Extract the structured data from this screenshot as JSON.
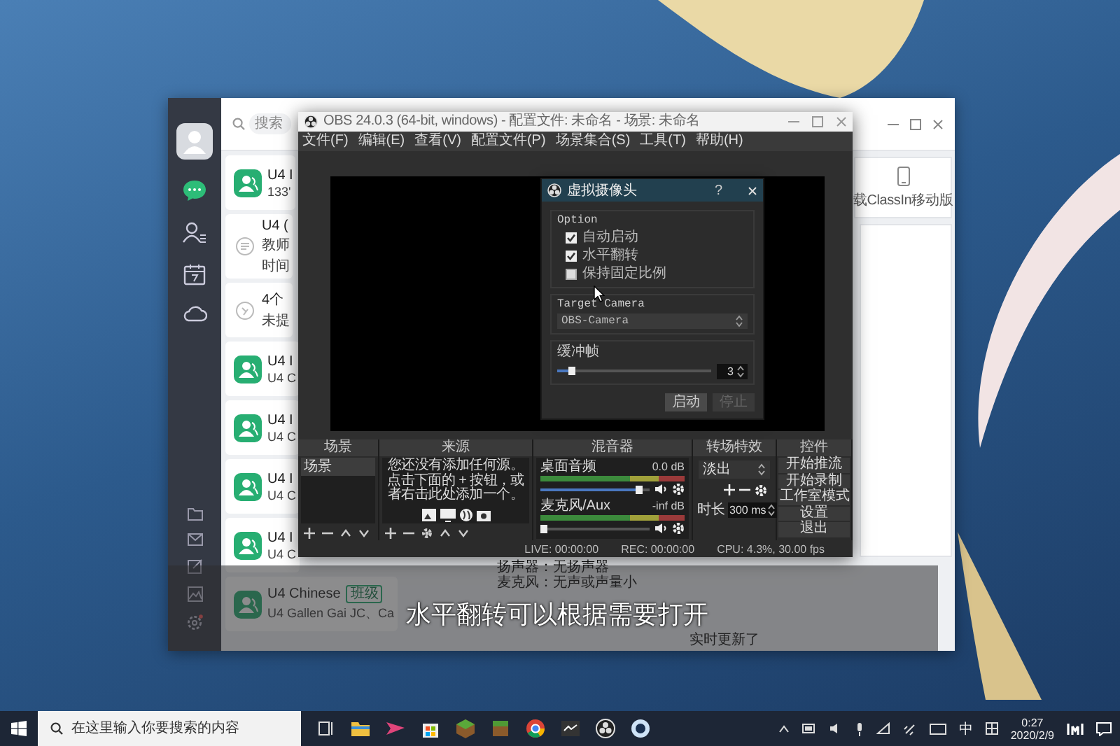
{
  "chat_app": {
    "search": {
      "placeholder": "搜索"
    },
    "conversations": [
      {
        "kind": "group",
        "title": "U4 I",
        "lines": [
          "133'"
        ],
        "selected": false
      },
      {
        "kind": "notice",
        "title": "U4 (",
        "lines": [
          "教师",
          "时间"
        ],
        "selected": false
      },
      {
        "kind": "task",
        "title": "4个",
        "lines": [
          "未提"
        ],
        "selected": false
      },
      {
        "kind": "group",
        "title": "U4 I",
        "lines": [
          "U4 C"
        ],
        "selected": false
      },
      {
        "kind": "group",
        "title": "U4 I",
        "lines": [
          "U4 C"
        ],
        "selected": false
      },
      {
        "kind": "group",
        "title": "U4 I",
        "lines": [
          "U4 C"
        ],
        "selected": false
      },
      {
        "kind": "group",
        "title": "U4 I",
        "lines": [
          "U4 C"
        ],
        "selected": false
      },
      {
        "kind": "group",
        "title": "U4 Chinese",
        "tag": "班级",
        "lines": [
          "U4 Gallen Gai JC、Ca"
        ],
        "selected": false
      }
    ],
    "mobile_download": "载ClassIn移动版",
    "status_lines": [
      "扬声器：无扬声器",
      "麦克风：无声或声量小",
      "实时更新了"
    ]
  },
  "obs": {
    "title": "OBS 24.0.3 (64-bit, windows) - 配置文件: 未命名 - 场景: 未命名",
    "menu": [
      "文件(F)",
      "编辑(E)",
      "查看(V)",
      "配置文件(P)",
      "场景集合(S)",
      "工具(T)",
      "帮助(H)"
    ],
    "scenes": {
      "title": "场景",
      "items": [
        {
          "label": "场景",
          "selected": true
        }
      ]
    },
    "sources": {
      "title": "来源",
      "hint": "您还没有添加任何源。点击下面的 + 按钮，或者右击此处添加一个。"
    },
    "mixer": {
      "title": "混音器",
      "channels": [
        {
          "name": "桌面音频",
          "reading": "0.0 dB",
          "level": 0.93
        },
        {
          "name": "麦克风/Aux",
          "reading": "-inf dB",
          "level": 0.06
        }
      ]
    },
    "transitions": {
      "title": "转场特效",
      "transition": "淡出",
      "duration_label": "时长",
      "duration": "300 ms"
    },
    "controls": {
      "title": "控件",
      "buttons": [
        "开始推流",
        "开始录制",
        "工作室模式",
        "设置",
        "退出"
      ]
    },
    "status": [
      "LIVE: 00:00:00",
      "REC: 00:00:00",
      "CPU: 4.3%, 30.00 fps"
    ]
  },
  "dialog": {
    "title": "虚拟摄像头",
    "help": "?",
    "option_label": "Option",
    "options": [
      {
        "label": "自动启动",
        "checked": true
      },
      {
        "label": "水平翻转",
        "checked": true
      },
      {
        "label": "保持固定比例",
        "checked": false
      }
    ],
    "target_camera_label": "Target Camera",
    "target_camera": "OBS-Camera",
    "buffer_label": "缓冲帧",
    "buffer": {
      "level": 0.12,
      "value": "3"
    },
    "buttons": [
      {
        "label": "启动",
        "disabled": false
      },
      {
        "label": "停止",
        "disabled": true
      }
    ]
  },
  "subtitle": "水平翻转可以根据需要打开",
  "taskbar": {
    "search": {
      "placeholder": "在这里输入你要搜索的内容"
    },
    "ime": "中",
    "time": "0:27",
    "date": "2020/2/9"
  }
}
